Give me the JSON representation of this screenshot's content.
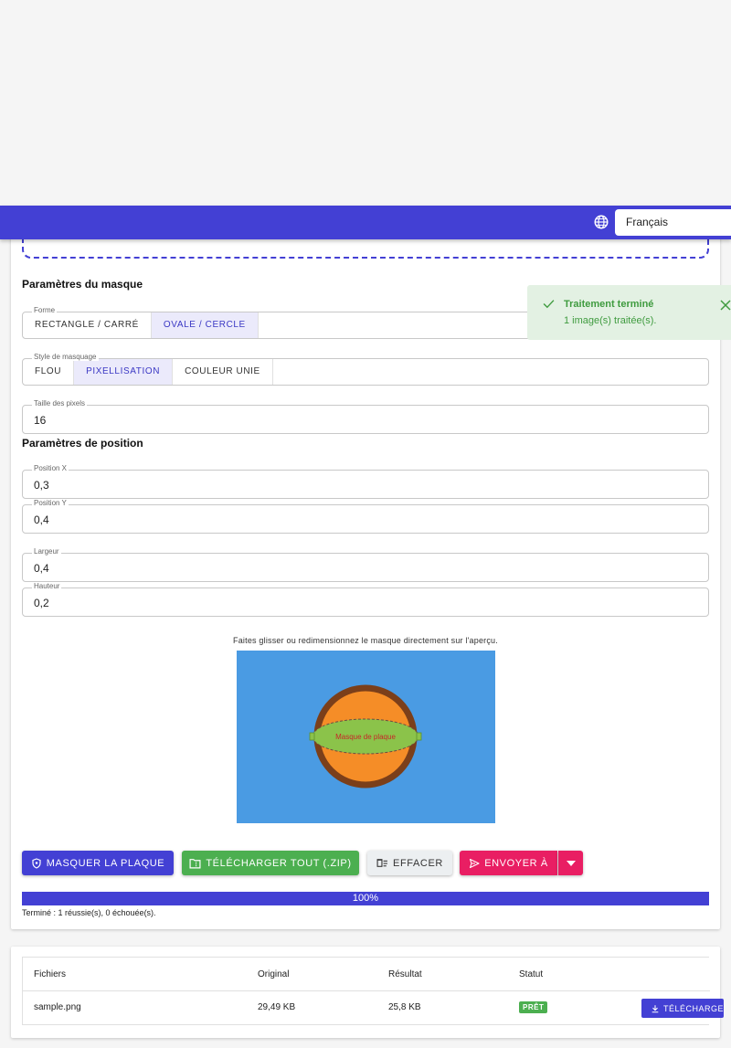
{
  "header": {
    "language": "Français"
  },
  "mask_params": {
    "title": "Paramètres du masque",
    "shape": {
      "legend": "Forme",
      "options": [
        "RECTANGLE / CARRÉ",
        "OVALE / CERCLE"
      ],
      "selected": "OVALE / CERCLE"
    },
    "style": {
      "legend": "Style de masquage",
      "options": [
        "FLOU",
        "PIXELLISATION",
        "COULEUR UNIE"
      ],
      "selected": "PIXELLISATION"
    },
    "pixel_size": {
      "label": "Taille des pixels",
      "value": "16"
    }
  },
  "position_params": {
    "title": "Paramètres de position",
    "x": {
      "label": "Position X",
      "value": "0,3"
    },
    "y": {
      "label": "Position Y",
      "value": "0,4"
    },
    "width": {
      "label": "Largeur",
      "value": "0,4"
    },
    "height": {
      "label": "Hauteur",
      "value": "0,2"
    }
  },
  "preview": {
    "hint": "Faites glisser ou redimensionnez le masque directement sur l'aperçu.",
    "mask_label": "Masque de plaque",
    "colors": {
      "background": "#4a9be3",
      "ball": "#f58d27",
      "ring": "#7b3f1a",
      "mask": "#8bc34a"
    }
  },
  "actions": {
    "mask": "MASQUER LA PLAQUE",
    "download_zip": "TÉLÉCHARGER TOUT (.ZIP)",
    "clear": "EFFACER",
    "send": "ENVOYER À"
  },
  "progress": {
    "percent_label": "100%",
    "status": "Terminé : 1 réussie(s), 0 échouée(s)."
  },
  "table": {
    "headers": {
      "files": "Fichiers",
      "original": "Original",
      "result": "Résultat",
      "status": "Statut"
    },
    "rows": [
      {
        "file": "sample.png",
        "original": "29,49 KB",
        "result": "25,8 KB",
        "status": "PRÊT",
        "download": "TÉLÉCHARGER"
      }
    ]
  },
  "toast": {
    "title": "Traitement terminé",
    "message": "1 image(s) traitée(s)."
  }
}
